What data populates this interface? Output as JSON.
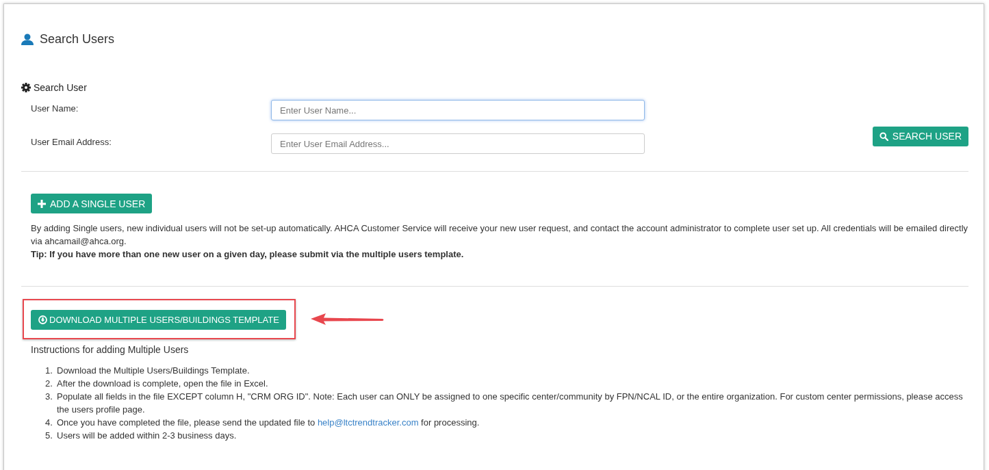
{
  "page_title": "Search Users",
  "search": {
    "heading": "Search User",
    "fields": [
      {
        "label": "User Name:",
        "placeholder": "Enter User Name...",
        "focused": true
      },
      {
        "label": "User Email Address:",
        "placeholder": "Enter User Email Address...",
        "focused": false
      }
    ],
    "button": "SEARCH USER"
  },
  "single_user": {
    "button": "ADD A SINGLE USER",
    "note": "By adding Single users, new individual users will not be set-up automatically. AHCA Customer Service will receive your new user request, and contact the account administrator to complete user set up. All credentials will be emailed directly via ahcamail@ahca.org.",
    "tip": "Tip: If you have more than one new user on a given day, please submit via the multiple users template."
  },
  "multiple_users": {
    "button": "DOWNLOAD MULTIPLE USERS/BUILDINGS TEMPLATE",
    "highlighted": true,
    "heading": "Instructions for adding Multiple Users",
    "steps": [
      {
        "number": "1.",
        "text": "Download the Multiple Users/Buildings Template."
      },
      {
        "number": "2.",
        "text": "After the download is complete, open the file in Excel."
      },
      {
        "number": "3.",
        "text": "Populate all fields in the file EXCEPT column H, \"CRM ORG ID\". Note: Each user can ONLY be assigned to one specific center/community by FPN/NCAL ID, or the entire organization. For custom center permissions, please access the users profile page."
      },
      {
        "number": "4.",
        "text": "Once you have completed the file, please send the updated file to",
        "link": "help@ltctrendtracker.com",
        "after": "for processing."
      },
      {
        "number": "5.",
        "text": "Users will be added within 2-3 business days."
      }
    ]
  }
}
